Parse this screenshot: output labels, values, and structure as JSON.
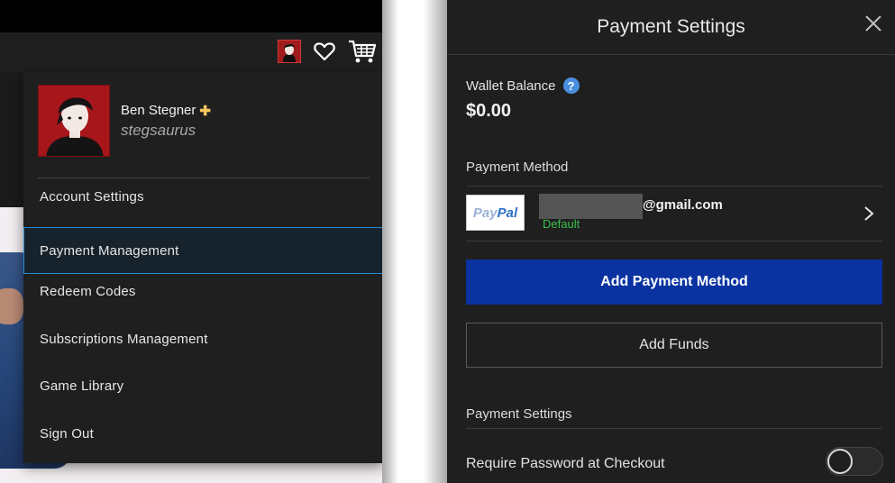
{
  "store": {
    "nav_icons": [
      "avatar",
      "heart-icon",
      "cart-icon"
    ],
    "profile": {
      "display_name": "Ben Stegner",
      "plus_badge": "✚",
      "handle": "stegsaurus"
    },
    "menu_items": [
      {
        "label": "Account Settings",
        "active": false
      },
      {
        "label": "Payment Management",
        "active": true
      },
      {
        "label": "Redeem Codes",
        "active": false
      },
      {
        "label": "Subscriptions Management",
        "active": false
      },
      {
        "label": "Game Library",
        "active": false
      },
      {
        "label": "Sign Out",
        "active": false
      }
    ]
  },
  "panel": {
    "title": "Payment Settings",
    "close_icon": "close-icon",
    "wallet": {
      "label": "Wallet Balance",
      "help": "?",
      "amount": "$0.00"
    },
    "payment_method": {
      "section_label": "Payment Method",
      "logo_part1": "Pay",
      "logo_part2": "Pal",
      "email_suffix": "@gmail.com",
      "default_label": "Default"
    },
    "add_payment_method_label": "Add Payment Method",
    "add_funds_label": "Add Funds",
    "settings": {
      "section_label": "Payment Settings",
      "require_password_label": "Require Password at Checkout",
      "require_password_enabled": false
    }
  },
  "colors": {
    "panel_bg": "#1f1f1f",
    "primary_button": "#0a33a1",
    "active_border": "#2a8cd0",
    "default_green": "#38c24a",
    "help_blue": "#4a8fe0"
  }
}
